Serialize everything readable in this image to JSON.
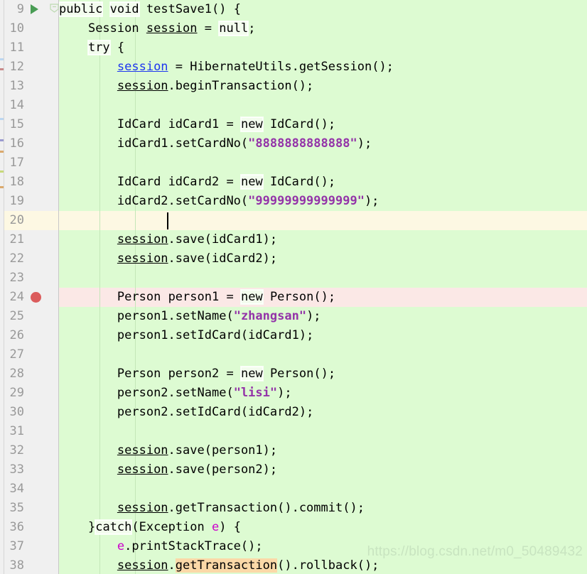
{
  "editor": {
    "language": "java",
    "background_color": "#ddfbd2",
    "gutter_color": "#f0f0f0",
    "caret_line_color": "#fdf8e3",
    "breakpoint_line_color": "#fbe8e6",
    "string_color": "#9333a8",
    "write_access_color": "#1d35f0",
    "parameter_color": "#cc00cc",
    "identifier_highlight_color": "#fbd9a8",
    "run_marker_color": "#499c54",
    "breakpoint_color": "#db5c5c",
    "first_visible_line": 9,
    "last_visible_line": 38,
    "caret_line": 20,
    "breakpoint_line": 24
  },
  "watermark": {
    "text": "https://blog.csdn.net/m0_50489432"
  },
  "gutter": {
    "icons": {
      "run": "run-triangle-icon",
      "fold": "fold-region-icon",
      "breakpoint": "breakpoint-icon"
    }
  },
  "lines": [
    {
      "n": 9,
      "indent": 0,
      "text": "public void testSave1() {"
    },
    {
      "n": 10,
      "indent": 1,
      "text": "Session session = null;"
    },
    {
      "n": 11,
      "indent": 1,
      "text": "try {"
    },
    {
      "n": 12,
      "indent": 2,
      "text": "session = HibernateUtils.getSession();"
    },
    {
      "n": 13,
      "indent": 2,
      "text": "session.beginTransaction();"
    },
    {
      "n": 14,
      "indent": 0,
      "text": ""
    },
    {
      "n": 15,
      "indent": 2,
      "text": "IdCard idCard1 = new IdCard();"
    },
    {
      "n": 16,
      "indent": 2,
      "text": "idCard1.setCardNo(\"8888888888888\");"
    },
    {
      "n": 17,
      "indent": 0,
      "text": ""
    },
    {
      "n": 18,
      "indent": 2,
      "text": "IdCard idCard2 = new IdCard();"
    },
    {
      "n": 19,
      "indent": 2,
      "text": "idCard2.setCardNo(\"99999999999999\");"
    },
    {
      "n": 20,
      "indent": 2,
      "text": ""
    },
    {
      "n": 21,
      "indent": 2,
      "text": "session.save(idCard1);"
    },
    {
      "n": 22,
      "indent": 2,
      "text": "session.save(idCard2);"
    },
    {
      "n": 23,
      "indent": 0,
      "text": ""
    },
    {
      "n": 24,
      "indent": 2,
      "text": "Person person1 = new Person();"
    },
    {
      "n": 25,
      "indent": 2,
      "text": "person1.setName(\"zhangsan\");"
    },
    {
      "n": 26,
      "indent": 2,
      "text": "person1.setIdCard(idCard1);"
    },
    {
      "n": 27,
      "indent": 0,
      "text": ""
    },
    {
      "n": 28,
      "indent": 2,
      "text": "Person person2 = new Person();"
    },
    {
      "n": 29,
      "indent": 2,
      "text": "person2.setName(\"lisi\");"
    },
    {
      "n": 30,
      "indent": 2,
      "text": "person2.setIdCard(idCard2);"
    },
    {
      "n": 31,
      "indent": 0,
      "text": ""
    },
    {
      "n": 32,
      "indent": 2,
      "text": "session.save(person1);"
    },
    {
      "n": 33,
      "indent": 2,
      "text": "session.save(person2);"
    },
    {
      "n": 34,
      "indent": 0,
      "text": ""
    },
    {
      "n": 35,
      "indent": 2,
      "text": "session.getTransaction().commit();"
    },
    {
      "n": 36,
      "indent": 1,
      "text": "}catch(Exception e) {"
    },
    {
      "n": 37,
      "indent": 2,
      "text": "e.printStackTrace();"
    },
    {
      "n": 38,
      "indent": 2,
      "text": "session.getTransaction().rollback();"
    }
  ],
  "strings": {
    "card_no_1": "8888888888888",
    "card_no_2": "99999999999999",
    "name_1": "zhangsan",
    "name_2": "lisi"
  },
  "keywords": [
    "public",
    "void",
    "null",
    "try",
    "new",
    "catch"
  ],
  "identifiers": {
    "method_name": "testSave1",
    "class_session": "Session",
    "class_idcard": "IdCard",
    "class_person": "Person",
    "class_exception": "Exception",
    "util_class": "HibernateUtils",
    "variables": [
      "session",
      "idCard1",
      "idCard2",
      "person1",
      "person2",
      "e"
    ],
    "methods": [
      "getSession",
      "beginTransaction",
      "setCardNo",
      "save",
      "setName",
      "setIdCard",
      "getTransaction",
      "commit",
      "printStackTrace",
      "rollback"
    ]
  }
}
